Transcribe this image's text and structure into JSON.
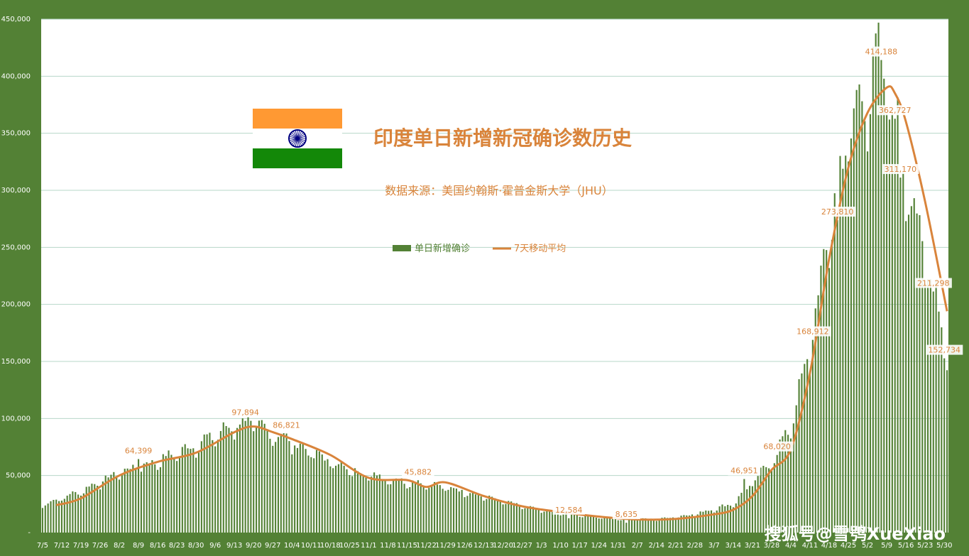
{
  "chart_data": {
    "type": "bar+line",
    "title": "印度单日新增新冠确诊数历史",
    "subtitle": "数据来源：美国约翰斯·霍普金斯大学（JHU）",
    "watermark": "搜狐号@雪鸮XueXiao",
    "ylim": [
      0,
      450000
    ],
    "y_ticks": [
      "-",
      "50,000",
      "100,000",
      "150,000",
      "200,000",
      "250,000",
      "300,000",
      "350,000",
      "400,000",
      "450,000"
    ],
    "x_tick_labels": [
      "7/5",
      "7/12",
      "7/19",
      "7/26",
      "8/2",
      "8/9",
      "8/16",
      "8/23",
      "8/30",
      "9/6",
      "9/13",
      "9/20",
      "9/27",
      "10/4",
      "10/11",
      "10/18",
      "10/25",
      "11/1",
      "11/8",
      "11/15",
      "11/22",
      "11/29",
      "12/6",
      "12/13",
      "12/20",
      "12/27",
      "1/3",
      "1/10",
      "1/17",
      "1/24",
      "1/31",
      "2/7",
      "2/14",
      "2/21",
      "2/28",
      "3/7",
      "3/14",
      "3/21",
      "3/28",
      "4/4",
      "4/11",
      "4/18",
      "4/25",
      "5/2",
      "5/9",
      "5/16",
      "5/23",
      "5/30"
    ],
    "x_start": "2020-07-05",
    "x_end": "2021-05-31",
    "legend": {
      "position": "top-center",
      "bar_label": "单日新增确诊",
      "line_label": "7天移动平均"
    },
    "colors": {
      "background": "#538135",
      "plot": "#ffffff",
      "bars": "#538135",
      "line": "#d9843b",
      "grid": "#b7d7c8",
      "text": "#d9843b"
    },
    "flag_colors": {
      "saffron": "#ff9933",
      "white": "#ffffff",
      "green": "#138808",
      "chakra": "#000080"
    },
    "daily_anchors": [
      {
        "date": "2020-07-05",
        "value": 24000
      },
      {
        "date": "2020-07-19",
        "value": 36000
      },
      {
        "date": "2020-08-02",
        "value": 52000
      },
      {
        "date": "2020-08-16",
        "value": 62000
      },
      {
        "date": "2020-08-30",
        "value": 76000
      },
      {
        "date": "2020-09-13",
        "value": 93000
      },
      {
        "date": "2020-09-17",
        "value": 97894
      },
      {
        "date": "2020-09-27",
        "value": 86000
      },
      {
        "date": "2020-10-11",
        "value": 70000
      },
      {
        "date": "2020-10-25",
        "value": 54000
      },
      {
        "date": "2020-11-08",
        "value": 47000
      },
      {
        "date": "2020-11-22",
        "value": 42000
      },
      {
        "date": "2020-12-06",
        "value": 36000
      },
      {
        "date": "2020-12-20",
        "value": 27000
      },
      {
        "date": "2021-01-03",
        "value": 19000
      },
      {
        "date": "2021-01-17",
        "value": 15000
      },
      {
        "date": "2021-01-31",
        "value": 12000
      },
      {
        "date": "2021-02-14",
        "value": 11500
      },
      {
        "date": "2021-02-28",
        "value": 16000
      },
      {
        "date": "2021-03-14",
        "value": 25000
      },
      {
        "date": "2021-03-28",
        "value": 62000
      },
      {
        "date": "2021-04-04",
        "value": 93000
      },
      {
        "date": "2021-04-11",
        "value": 160000
      },
      {
        "date": "2021-04-18",
        "value": 262000
      },
      {
        "date": "2021-04-25",
        "value": 350000
      },
      {
        "date": "2021-05-02",
        "value": 385000
      },
      {
        "date": "2021-05-07",
        "value": 414188
      },
      {
        "date": "2021-05-12",
        "value": 362727
      },
      {
        "date": "2021-05-16",
        "value": 311170
      },
      {
        "date": "2021-05-23",
        "value": 240000
      },
      {
        "date": "2021-05-27",
        "value": 211298
      },
      {
        "date": "2021-05-31",
        "value": 152734
      }
    ],
    "moving_average": [
      {
        "date": "2020-07-10",
        "value": 24000
      },
      {
        "date": "2020-07-19",
        "value": 30000
      },
      {
        "date": "2020-08-02",
        "value": 50000
      },
      {
        "date": "2020-08-16",
        "value": 62000
      },
      {
        "date": "2020-08-30",
        "value": 70000
      },
      {
        "date": "2020-09-13",
        "value": 88000
      },
      {
        "date": "2020-09-20",
        "value": 93000
      },
      {
        "date": "2020-09-27",
        "value": 88000
      },
      {
        "date": "2020-10-04",
        "value": 82000
      },
      {
        "date": "2020-10-18",
        "value": 68000
      },
      {
        "date": "2020-11-01",
        "value": 48000
      },
      {
        "date": "2020-11-15",
        "value": 46000
      },
      {
        "date": "2020-11-22",
        "value": 40000
      },
      {
        "date": "2020-11-29",
        "value": 44000
      },
      {
        "date": "2020-12-13",
        "value": 32000
      },
      {
        "date": "2020-12-27",
        "value": 23000
      },
      {
        "date": "2021-01-10",
        "value": 18000
      },
      {
        "date": "2021-01-24",
        "value": 14000
      },
      {
        "date": "2021-02-07",
        "value": 11500
      },
      {
        "date": "2021-02-21",
        "value": 12000
      },
      {
        "date": "2021-03-07",
        "value": 16000
      },
      {
        "date": "2021-03-14",
        "value": 20000
      },
      {
        "date": "2021-03-21",
        "value": 32000
      },
      {
        "date": "2021-03-28",
        "value": 55000
      },
      {
        "date": "2021-04-04",
        "value": 73000
      },
      {
        "date": "2021-04-11",
        "value": 140000
      },
      {
        "date": "2021-04-18",
        "value": 240000
      },
      {
        "date": "2021-04-25",
        "value": 320000
      },
      {
        "date": "2021-05-02",
        "value": 368000
      },
      {
        "date": "2021-05-09",
        "value": 390000
      },
      {
        "date": "2021-05-12",
        "value": 385000
      },
      {
        "date": "2021-05-16",
        "value": 360000
      },
      {
        "date": "2021-05-23",
        "value": 290000
      },
      {
        "date": "2021-05-31",
        "value": 194000
      }
    ],
    "data_labels": [
      {
        "date": "2020-08-09",
        "value": 64399,
        "text": "64,399"
      },
      {
        "date": "2020-09-17",
        "value": 97894,
        "text": "97,894"
      },
      {
        "date": "2020-10-02",
        "value": 86821,
        "text": "86,821"
      },
      {
        "date": "2020-11-19",
        "value": 45882,
        "text": "45,882"
      },
      {
        "date": "2021-01-13",
        "value": 12584,
        "text": "12,584"
      },
      {
        "date": "2021-02-03",
        "value": 8635,
        "text": "8,635"
      },
      {
        "date": "2021-03-18",
        "value": 46951,
        "text": "46,951"
      },
      {
        "date": "2021-03-30",
        "value": 68020,
        "text": "68,020"
      },
      {
        "date": "2021-04-12",
        "value": 168912,
        "text": "168,912"
      },
      {
        "date": "2021-04-21",
        "value": 273810,
        "text": "273,810"
      },
      {
        "date": "2021-05-07",
        "value": 414188,
        "text": "414,188"
      },
      {
        "date": "2021-05-12",
        "value": 362727,
        "text": "362,727"
      },
      {
        "date": "2021-05-14",
        "value": 311170,
        "text": "311,170"
      },
      {
        "date": "2021-05-26",
        "value": 211298,
        "text": "211,298"
      },
      {
        "date": "2021-05-30",
        "value": 152734,
        "text": "152,734"
      }
    ]
  }
}
